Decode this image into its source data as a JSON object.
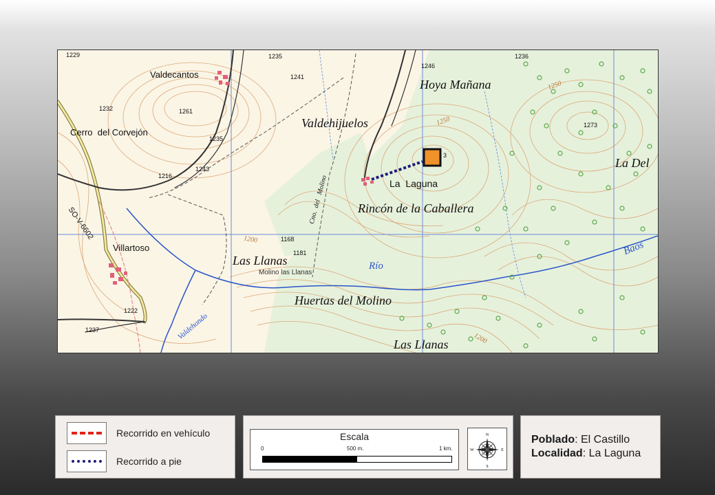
{
  "map": {
    "place_labels": [
      {
        "text": "Valdecantos",
        "kind": "village"
      },
      {
        "text": "Cerro  del Corvejón",
        "kind": "sans"
      },
      {
        "text": "Villartoso",
        "kind": "village"
      },
      {
        "text": "La  Laguna",
        "kind": "village"
      },
      {
        "text": "Hoya Mañana",
        "kind": "serif"
      },
      {
        "text": "Valdehijuelos",
        "kind": "serif"
      },
      {
        "text": "Rincón de la Caballera",
        "kind": "serif"
      },
      {
        "text": "Las Llanas",
        "kind": "serif"
      },
      {
        "text": "Huertas del Molino",
        "kind": "serif"
      },
      {
        "text": "Las Llanas",
        "kind": "serif"
      },
      {
        "text": "La Del",
        "kind": "serif"
      },
      {
        "text": "Molino las Llanas",
        "kind": "small"
      },
      {
        "text": "Río",
        "kind": "water"
      },
      {
        "text": "Baos",
        "kind": "water"
      },
      {
        "text": "Valdehondo",
        "kind": "water"
      },
      {
        "text": "SO-V-6602",
        "kind": "road"
      },
      {
        "text": "Cno.  del   Molino",
        "kind": "path"
      }
    ],
    "spot_heights": [
      "1229",
      "1235",
      "1241",
      "1246",
      "1236",
      "1232",
      "1261",
      "1235",
      "1216",
      "1243",
      "1168",
      "1181",
      "1222",
      "1237",
      "1273",
      "3"
    ],
    "contour_labels": [
      "1250",
      "1250",
      "1200",
      "1200"
    ],
    "marker_color": "#f0922a",
    "foot_route_color": "#1c1c7a",
    "vehicle_route_color": "#e2231a",
    "water_color": "#2a55c8"
  },
  "legend": {
    "vehicle_label": "Recorrido en vehículo",
    "foot_label": "Recorrido a pie"
  },
  "scale": {
    "title": "Escala",
    "tick_start": "0",
    "tick_mid": "500 m.",
    "tick_end": "1 km.",
    "compass_icon": "compass-rose",
    "compass_letters": {
      "n": "N",
      "s": "S",
      "e": "E",
      "w": "W"
    }
  },
  "info": {
    "poblado_label": "Poblado",
    "poblado_value": ": El Castillo",
    "localidad_label": "Localidad",
    "localidad_value": ": La Laguna"
  }
}
